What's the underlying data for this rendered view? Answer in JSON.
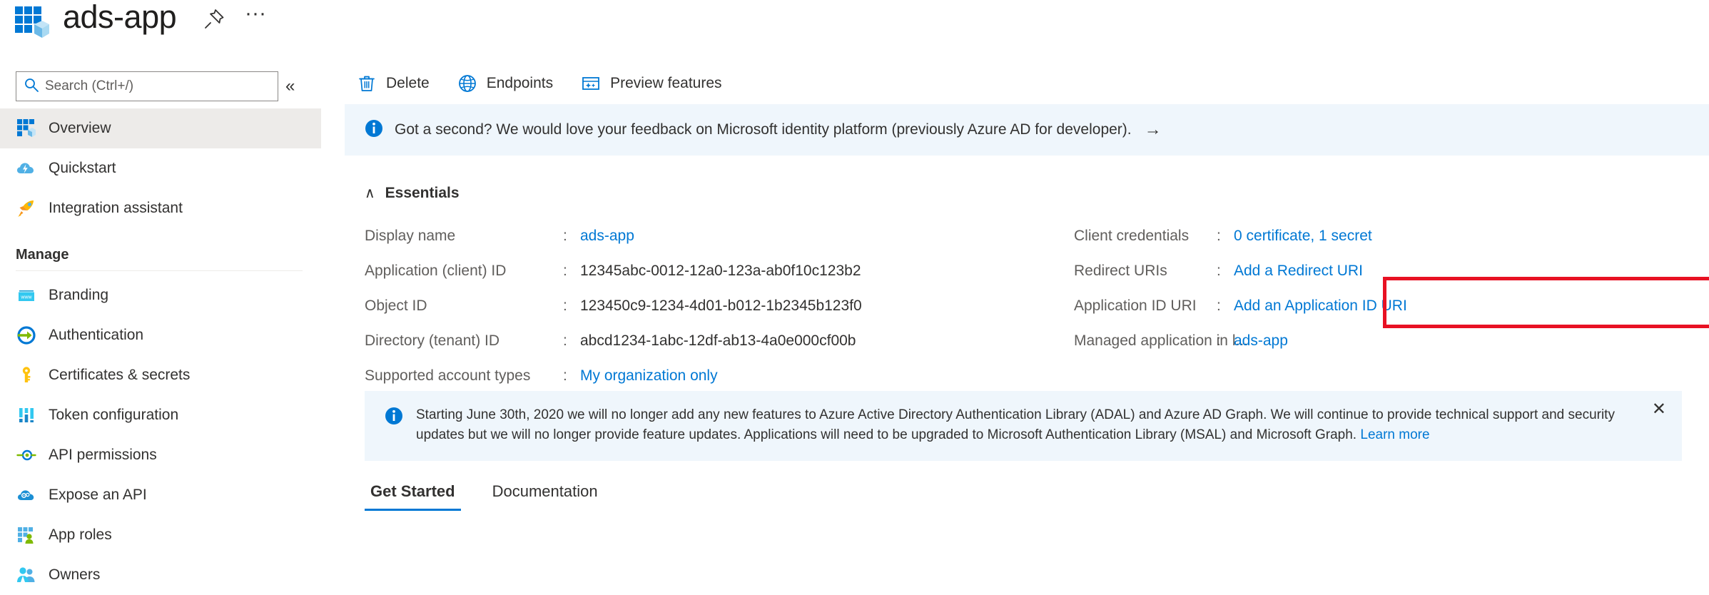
{
  "header": {
    "title": "ads-app",
    "app_icon": "app-registration-icon",
    "pin_icon": "pin-icon",
    "more_label": "···"
  },
  "sidebar": {
    "search": {
      "placeholder": "Search (Ctrl+/)",
      "value": "",
      "icon": "search-icon"
    },
    "collapse_label": "«",
    "items": [
      {
        "label": "Overview",
        "icon": "overview-icon",
        "selected": true
      },
      {
        "label": "Quickstart",
        "icon": "quickstart-cloud-icon",
        "selected": false
      },
      {
        "label": "Integration assistant",
        "icon": "rocket-icon",
        "selected": false
      }
    ],
    "group_label": "Manage",
    "manage_items": [
      {
        "label": "Branding",
        "icon": "branding-www-icon"
      },
      {
        "label": "Authentication",
        "icon": "authentication-arrow-icon"
      },
      {
        "label": "Certificates & secrets",
        "icon": "key-icon"
      },
      {
        "label": "Token configuration",
        "icon": "token-configuration-icon"
      },
      {
        "label": "API permissions",
        "icon": "api-permissions-icon"
      },
      {
        "label": "Expose an API",
        "icon": "expose-api-cloud-icon"
      },
      {
        "label": "App roles",
        "icon": "app-roles-icon"
      },
      {
        "label": "Owners",
        "icon": "owners-people-icon"
      }
    ]
  },
  "commandbar": {
    "delete": {
      "label": "Delete",
      "icon": "trash-icon"
    },
    "endpoints": {
      "label": "Endpoints",
      "icon": "globe-icon"
    },
    "preview": {
      "label": "Preview features",
      "icon": "preview-features-icon"
    }
  },
  "feedback_banner": {
    "icon": "info-icon",
    "text": "Got a second? We would love your feedback on Microsoft identity platform (previously Azure AD for developer).",
    "arrow": "→"
  },
  "essentials": {
    "chevron": "∧",
    "title": "Essentials",
    "colon": ":",
    "left_rows": [
      {
        "label": "Display name",
        "value": "ads-app",
        "link": true
      },
      {
        "label": "Application (client) ID",
        "value": "12345abc-0012-12a0-123a-ab0f10c123b2",
        "link": false
      },
      {
        "label": "Object ID",
        "value": "123450c9-1234-4d01-b012-1b2345b123f0",
        "link": false
      },
      {
        "label": "Directory (tenant) ID",
        "value": "abcd1234-1abc-12df-ab13-4a0e000cf00b",
        "link": false
      },
      {
        "label": "Supported account types",
        "value": "My organization only",
        "link": true
      }
    ],
    "right_rows": [
      {
        "label": "Client credentials",
        "value": "0 certificate, 1 secret",
        "link": true,
        "highlighted": true
      },
      {
        "label": "Redirect URIs",
        "value": "Add a Redirect URI",
        "link": true,
        "highlighted": false
      },
      {
        "label": "Application ID URI",
        "value": "Add an Application ID URI",
        "link": true,
        "highlighted": false
      },
      {
        "label": "Managed application in l...",
        "value": "ads-app",
        "link": true,
        "highlighted": false
      }
    ],
    "highlight_color": "#e81123"
  },
  "deprecation_notice": {
    "icon": "info-icon",
    "text": "Starting June 30th, 2020 we will no longer add any new features to Azure Active Directory Authentication Library (ADAL) and Azure AD Graph. We will continue to provide technical support and security updates but we will no longer provide feature updates. Applications will need to be upgraded to Microsoft Authentication Library (MSAL) and Microsoft Graph.",
    "link_label": "Learn more",
    "close_label": "✕"
  },
  "tabs": [
    {
      "label": "Get Started",
      "active": true
    },
    {
      "label": "Documentation",
      "active": false
    }
  ],
  "colors": {
    "accent": "#0078d4",
    "banner_bg": "#eff6fc",
    "selected_bg": "#edebe9",
    "highlight": "#e81123"
  }
}
